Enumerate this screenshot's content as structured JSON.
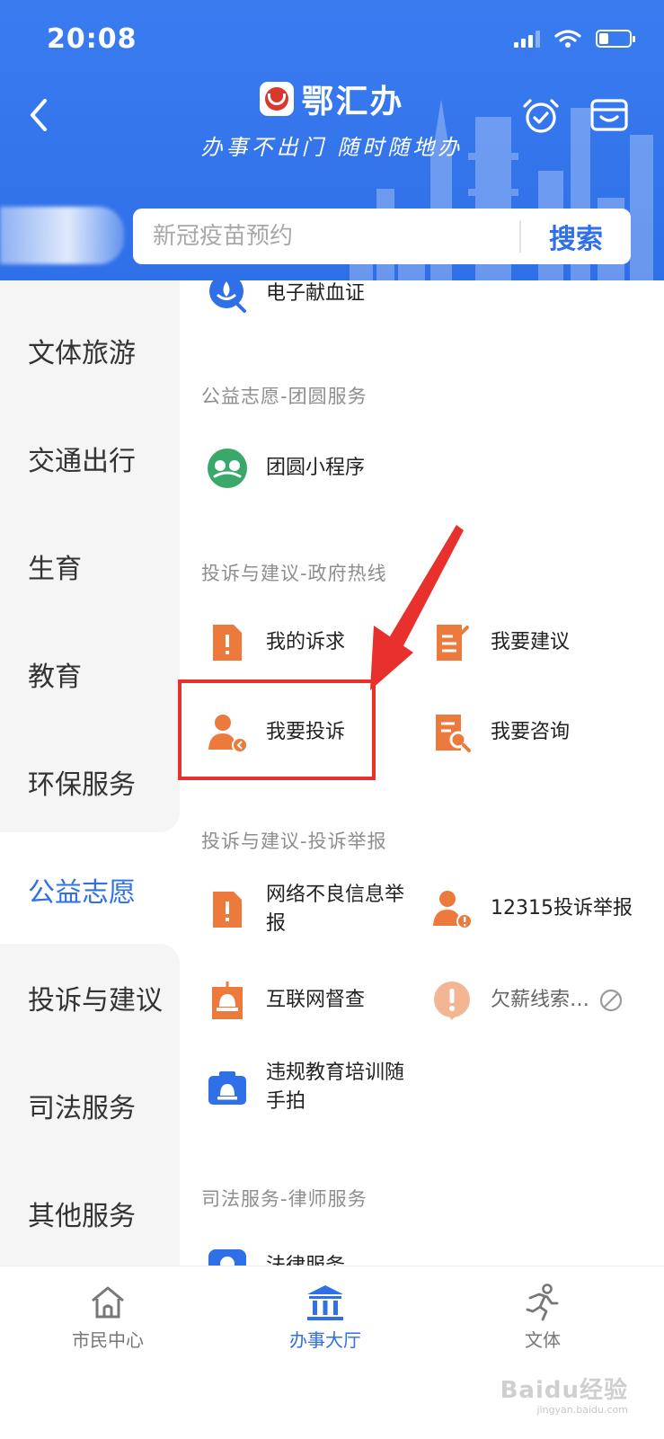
{
  "status_bar": {
    "time": "20:08"
  },
  "header": {
    "app_title": "鄂汇办",
    "slogan": "办事不出门 随时随地办",
    "search": {
      "placeholder": "新冠疫苗预约",
      "button_label": "搜索"
    }
  },
  "sidebar": {
    "items": [
      {
        "label": "文体旅游"
      },
      {
        "label": "交通出行"
      },
      {
        "label": "生育"
      },
      {
        "label": "教育"
      },
      {
        "label": "环保服务"
      },
      {
        "label": "公益志愿",
        "active": true
      },
      {
        "label": "投诉与建议"
      },
      {
        "label": "司法服务"
      },
      {
        "label": "其他服务"
      }
    ]
  },
  "content": {
    "partial_top_item": {
      "label": "电子献血证",
      "icon": "blood-donation-icon"
    },
    "sections": [
      {
        "title": "公益志愿-团圆服务",
        "items": [
          {
            "label": "团圆小程序",
            "icon": "reunion-miniprogram-icon"
          }
        ]
      },
      {
        "title": "投诉与建议-政府热线",
        "items": [
          {
            "label": "我的诉求",
            "icon": "document-alert-icon"
          },
          {
            "label": "我要建议",
            "icon": "document-edit-icon"
          },
          {
            "label": "我要投诉",
            "icon": "person-complaint-icon"
          },
          {
            "label": "我要咨询",
            "icon": "document-search-icon"
          }
        ]
      },
      {
        "title": "投诉与建议-投诉举报",
        "items": [
          {
            "label": "网络不良信息举报",
            "icon": "document-alert-icon"
          },
          {
            "label": "12315投诉举报",
            "icon": "person-alert-icon"
          },
          {
            "label": "互联网督查",
            "icon": "siren-document-icon"
          },
          {
            "label": "欠薪线索…",
            "icon": "exclamation-bubble-icon",
            "disabled": true
          },
          {
            "label": "违规教育培训随手拍",
            "icon": "camera-siren-icon"
          }
        ]
      },
      {
        "title": "司法服务-律师服务",
        "items": [
          {
            "label": "法律服务",
            "icon": "legal-service-icon"
          }
        ]
      }
    ]
  },
  "tabbar": {
    "tabs": [
      {
        "label": "市民中心",
        "icon": "home-icon"
      },
      {
        "label": "办事大厅",
        "icon": "government-building-icon",
        "active": true
      },
      {
        "label": "文体",
        "icon": "running-person-icon"
      }
    ]
  },
  "watermark": {
    "text": "Baidu经验",
    "sub": "jingyan.baidu.com"
  },
  "colors": {
    "brand_blue": "#2f6fe8",
    "icon_orange": "#ec7a3c",
    "icon_blue": "#2f6fe8",
    "icon_green": "#3aa86a",
    "annotation_red": "#e8302c"
  }
}
